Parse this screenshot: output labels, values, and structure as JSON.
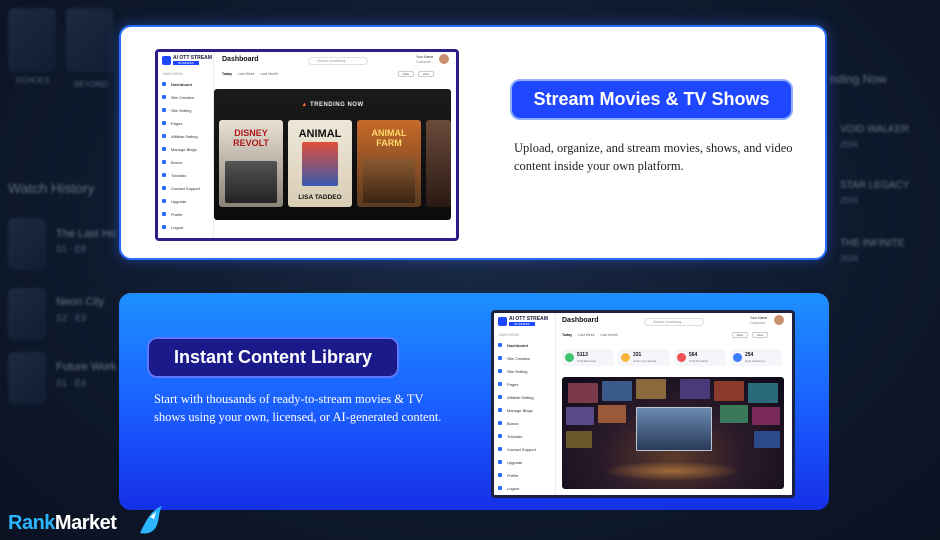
{
  "background": {
    "labels": [
      "ECHOES",
      "BEYOND",
      "Watch History",
      "The Last Ho",
      "S1 · E8",
      "Neon City",
      "S2 · E3",
      "Future Work",
      "S1 · E4",
      "nding Now",
      "VOID WALKER",
      "2024",
      "STAR LEGACY",
      "2024",
      "THE INFINITE",
      "2024"
    ]
  },
  "card1": {
    "heading": "Stream Movies & TV Shows",
    "description": "Upload, organize, and stream movies, shows, and video content inside your own platform.",
    "screenshot": {
      "logo_title": "AI OTT STREAM",
      "logo_badge": "BUSINESS",
      "page_title": "Dashboard",
      "search_placeholder": "Search something...",
      "user_name": "Your Name",
      "user_role": "Customer",
      "main_menu": "MAIN MENU",
      "menu": [
        "Dashboard",
        "Site Creation",
        "Site Setting",
        "Pages",
        "Affiliate Setting",
        "Manage Blogs",
        "Bonus",
        "Tutorials",
        "Contact Support",
        "Upgrade",
        "Profile",
        "Logout"
      ],
      "tabs": [
        "Today",
        "Last Week",
        "Last Month"
      ],
      "filter_label": "Filter",
      "view_label": "View",
      "trending_title": "TRENDING NOW",
      "posters": [
        "DISNEY REVOLT",
        "ANIMAL",
        "ANIMAL FARM"
      ],
      "poster_subtitles": [
        "",
        "LISA TADDEO",
        ""
      ]
    }
  },
  "card2": {
    "heading": "Instant Content Library",
    "description": "Start with thousands of ready-to-stream movies & TV shows using your own, licensed, or AI-generated content.",
    "screenshot": {
      "logo_title": "AI OTT STREAM",
      "logo_badge": "BUSINESS",
      "page_title": "Dashboard",
      "search_placeholder": "Search something...",
      "user_name": "Your Name",
      "user_role": "Customer",
      "main_menu": "MAIN MENU",
      "menu": [
        "Dashboard",
        "Site Creation",
        "Site Setting",
        "Pages",
        "Affiliate Setting",
        "Manage Blogs",
        "Bonus",
        "Tutorials",
        "Contact Support",
        "Upgrade",
        "Profile",
        "Logout"
      ],
      "tabs": [
        "Today",
        "Last Week",
        "Last Month"
      ],
      "filter_label": "Filter",
      "view_label": "View",
      "stats": [
        {
          "value": "5113",
          "label": "Total Revenue",
          "color": "#3ec46d"
        },
        {
          "value": "331",
          "label": "Order Completed",
          "color": "#f5b640"
        },
        {
          "value": "564",
          "label": "Total Products",
          "color": "#f05050"
        },
        {
          "value": "254",
          "label": "New Customer",
          "color": "#3a7bff"
        }
      ]
    }
  },
  "brand": {
    "part1": "Rank",
    "part2": "Market"
  },
  "colors": {
    "accent_blue": "#1f47ff",
    "card_border": "#2a6cff",
    "brand_cyan": "#2bb6ff"
  }
}
